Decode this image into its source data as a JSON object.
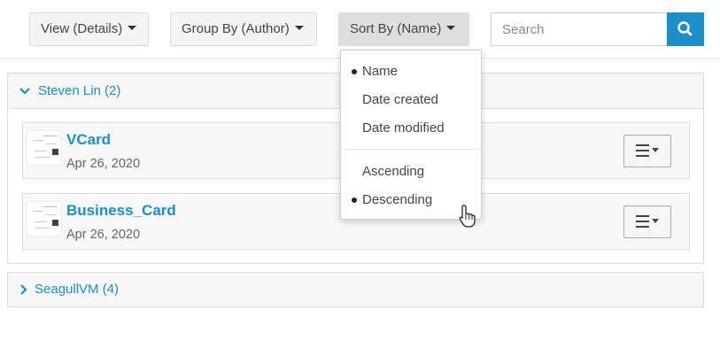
{
  "toolbar": {
    "view_label": "View (Details)",
    "group_label": "Group By (Author)",
    "sort_label": "Sort By (Name)",
    "search_placeholder": "Search",
    "search_icon": "search-icon"
  },
  "sort_menu": {
    "field_options": [
      {
        "label": "Name",
        "selected": true
      },
      {
        "label": "Date created",
        "selected": false
      },
      {
        "label": "Date modified",
        "selected": false
      }
    ],
    "order_options": [
      {
        "label": "Ascending",
        "selected": false
      },
      {
        "label": "Descending",
        "selected": true
      }
    ]
  },
  "groups": [
    {
      "title": "Steven Lin (2)",
      "expanded": true,
      "items": [
        {
          "title": "VCard",
          "date": "Apr 26, 2020"
        },
        {
          "title": "Business_Card",
          "date": "Apr 26, 2020"
        }
      ]
    },
    {
      "title": "SeagullVM (4)",
      "expanded": false
    }
  ],
  "colors": {
    "accent": "#1a8fc9",
    "button_bg": "#f4f4f4",
    "active_button_bg": "#dedede"
  }
}
